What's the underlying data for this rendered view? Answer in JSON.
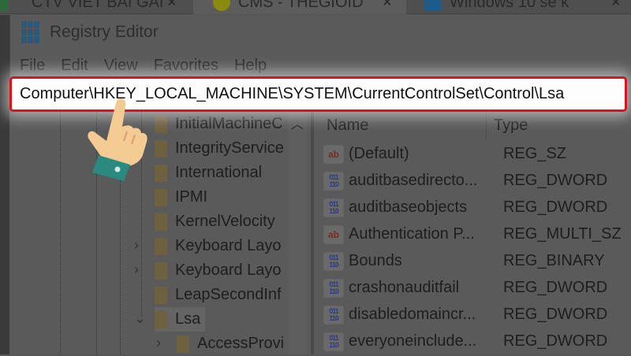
{
  "browser_tabs": [
    {
      "label": "CTV VIET BAI GAI",
      "close": "×"
    },
    {
      "label": "CMS - THEGIOID",
      "close": "×"
    },
    {
      "label": "Windows 10 se k",
      "close": "×"
    }
  ],
  "window": {
    "title": "Registry Editor"
  },
  "menu": [
    "File",
    "Edit",
    "View",
    "Favorites",
    "Help"
  ],
  "address_bar": {
    "value": "Computer\\HKEY_LOCAL_MACHINE\\SYSTEM\\CurrentControlSet\\Control\\Lsa",
    "highlight_color": "#d9141b"
  },
  "tree": {
    "items": [
      {
        "label": "InitialMachineC",
        "expander": ""
      },
      {
        "label": "IntegrityService",
        "expander": ""
      },
      {
        "label": "International",
        "expander": ""
      },
      {
        "label": "IPMI",
        "expander": ""
      },
      {
        "label": "KernelVelocity",
        "expander": ""
      },
      {
        "label": "Keyboard Layo",
        "expander": "›"
      },
      {
        "label": "Keyboard Layo",
        "expander": "›"
      },
      {
        "label": "LeapSecondInf",
        "expander": ""
      },
      {
        "label": "Lsa",
        "expander": "⌄"
      },
      {
        "label": "AccessProvi",
        "expander": "›"
      }
    ]
  },
  "list": {
    "columns": [
      "Name",
      "Type"
    ],
    "rows": [
      {
        "icon": "ab",
        "name": "(Default)",
        "type": "REG_SZ"
      },
      {
        "icon": "bin",
        "name": "auditbasedirecto...",
        "type": "REG_DWORD"
      },
      {
        "icon": "bin",
        "name": "auditbaseobjects",
        "type": "REG_DWORD"
      },
      {
        "icon": "ab",
        "name": "Authentication P...",
        "type": "REG_MULTI_SZ"
      },
      {
        "icon": "bin",
        "name": "Bounds",
        "type": "REG_BINARY"
      },
      {
        "icon": "bin",
        "name": "crashonauditfail",
        "type": "REG_DWORD"
      },
      {
        "icon": "bin",
        "name": "disabledomaincr...",
        "type": "REG_DWORD"
      },
      {
        "icon": "bin",
        "name": "everyoneinclude...",
        "type": "REG_DWORD"
      }
    ],
    "icon_labels": {
      "ab": "ab",
      "bin": "011\n110"
    }
  }
}
